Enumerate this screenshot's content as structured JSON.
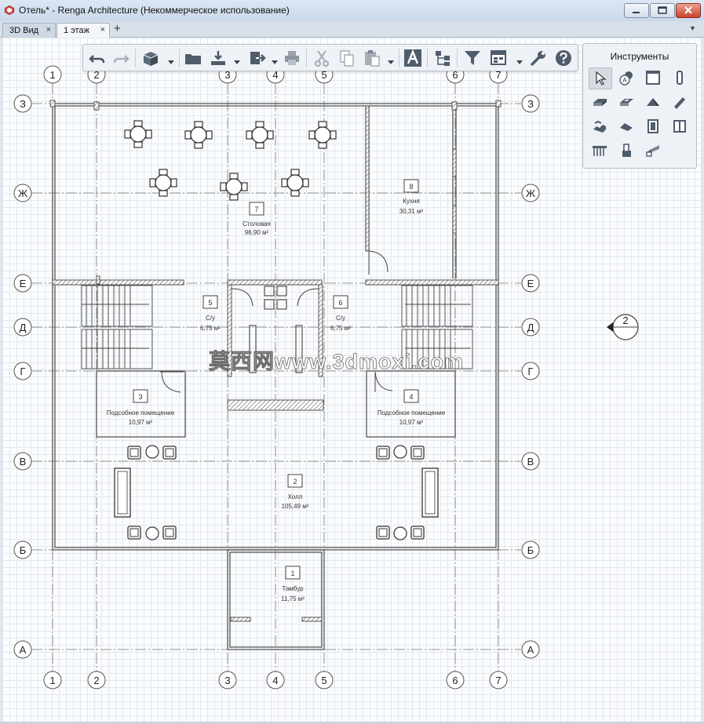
{
  "window": {
    "title": "Отель* - Renga Architecture (Некоммерческое использование)",
    "controls": [
      "minimize",
      "maximize",
      "close"
    ]
  },
  "tabs": [
    {
      "label": "3D Вид",
      "close": "×",
      "active": false
    },
    {
      "label": "1 этаж",
      "close": "×",
      "active": true
    }
  ],
  "tab_add": "+",
  "tab_menu": "▼",
  "toolbar": {
    "buttons": [
      "undo-icon",
      "redo-icon",
      "view-3d-icon",
      "open-folder-icon",
      "import-icon",
      "export-icon",
      "print-icon",
      "cut-icon",
      "copy-icon",
      "paste-icon",
      "text-style-icon",
      "hierarchy-icon",
      "filter-icon",
      "properties-icon",
      "settings-wrench-icon",
      "help-icon"
    ]
  },
  "tools": {
    "title": "Инструменты",
    "items": [
      "select-tool-icon",
      "annotation-tool-icon",
      "wall-tool-icon",
      "column-tool-icon",
      "slab-tool-icon",
      "opening-tool-icon",
      "roof-tool-icon",
      "beam-tool-icon",
      "stair-tool-icon",
      "ramp-tool-icon",
      "door-tool-icon",
      "window-tool-icon",
      "railing-tool-icon",
      "equipment-tool-icon",
      "element-tool-icon"
    ]
  },
  "plan": {
    "axes_vertical": [
      "1",
      "2",
      "3",
      "4",
      "5",
      "6",
      "7"
    ],
    "axes_horizontal": [
      "З",
      "Ж",
      "Е",
      "Д",
      "Г",
      "В",
      "Б",
      "А"
    ],
    "section_mark": "2",
    "rooms": [
      {
        "num": "7",
        "name": "Столовая",
        "area": "96,90 м²"
      },
      {
        "num": "8",
        "name": "Кухня",
        "area": "30,31 м²"
      },
      {
        "num": "5",
        "name": "С/у",
        "area": "6,75 м²"
      },
      {
        "num": "6",
        "name": "С/у",
        "area": "6,75 м²"
      },
      {
        "num": "3",
        "name": "Подсобное помещение",
        "area": "10,97 м²"
      },
      {
        "num": "4",
        "name": "Подсобное помещение",
        "area": "10,97 м²"
      },
      {
        "num": "2",
        "name": "Холл",
        "area": "105,49 м²"
      },
      {
        "num": "1",
        "name": "Тамбур",
        "area": "11,75 м²"
      }
    ],
    "watermark": "莫西网www.3dmoxi.com"
  },
  "colors": {
    "accent": "#c8432c",
    "wall": "#555555",
    "axis": "#777777",
    "titlebar": "#d5e1ef"
  }
}
